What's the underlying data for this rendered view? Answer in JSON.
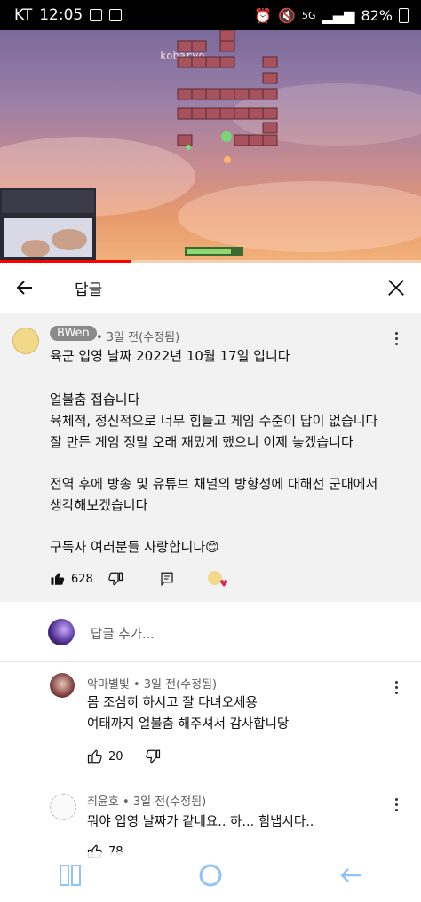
{
  "status_bar": {
    "carrier": "KT",
    "time": "12:05",
    "battery": "82%",
    "network": "5G"
  },
  "video": {
    "overlay_name": "kobaryo",
    "progress_fraction": 0.31
  },
  "header": {
    "title": "답글"
  },
  "parent_comment": {
    "author": "BWen",
    "meta": "• 3일 전(수정됨)",
    "lines": [
      "육군 입영 날짜 2022년 10월 17일 입니다",
      "",
      "얼불춤 접습니다",
      "육체적, 정신적으로 너무 힘들고 게임 수준이 답이 없습니다",
      "잘 만든 게임 정말 오래 재밌게 했으니 이제 놓겠습니다",
      "",
      "전역 후에 방송 및 유튜브 채널의 방향성에 대해선 군대에서",
      "생각해보겠습니다",
      "",
      "구독자 여러분들 사랑합니다😊"
    ],
    "like_count": "628"
  },
  "reply_input": {
    "placeholder": "답글 추가..."
  },
  "replies": [
    {
      "author": "악마별빛",
      "meta": "• 3일 전(수정됨)",
      "lines": [
        "몸 조심히 하시고 잘 다녀오세용",
        "여태까지 얼불춤 해주셔서 감사합니당"
      ],
      "like_count": "20"
    },
    {
      "author": "최윤호",
      "meta": "• 3일 전(수정됨)",
      "lines": [
        "뭐야 입영 날짜가 같네요.. 하... 힘냅시다.."
      ],
      "like_count": "78"
    }
  ],
  "colors": {
    "accent_red": "#ff0000",
    "parent_bg": "#f2f2f2"
  }
}
